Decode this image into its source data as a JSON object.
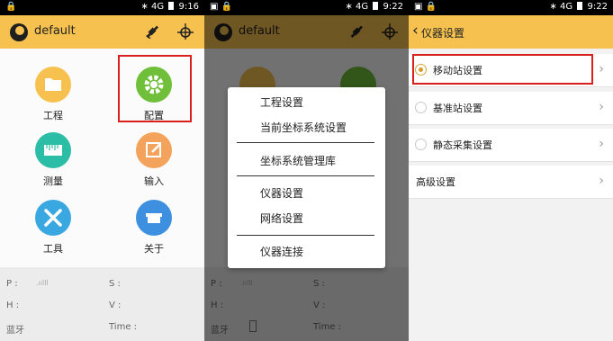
{
  "status_left_1": "🔒",
  "status_p1": {
    "bt": "∗",
    "net": "4G",
    "time": "9:16"
  },
  "status_p2": {
    "bt": "∗",
    "net": "4G",
    "time": "9:22"
  },
  "status_p3": {
    "bt": "∗",
    "net": "4G",
    "time": "9:22"
  },
  "app_title": "default",
  "tiles": [
    {
      "label": "工程",
      "color": "#f6c14e"
    },
    {
      "label": "配置",
      "color": "#6fbf3a"
    },
    {
      "label": "测量",
      "color": "#2cbda6"
    },
    {
      "label": "输入",
      "color": "#f3a35b"
    },
    {
      "label": "工具",
      "color": "#3aa8e0"
    },
    {
      "label": "关于",
      "color": "#3d8fe0"
    }
  ],
  "info": {
    "p": "P :",
    "s": "S :",
    "h": "H :",
    "v": "V :",
    "bt": "蓝牙",
    "time": "Time :"
  },
  "menu": [
    "工程设置",
    "当前坐标系统设置",
    "坐标系统管理库",
    "仪器设置",
    "网络设置",
    "仪器连接"
  ],
  "settings": {
    "back": "‹",
    "title": "仪器设置",
    "rows": [
      "移动站设置",
      "基准站设置",
      "静态采集设置",
      "高级设置"
    ],
    "chevron": "›"
  },
  "colors": {
    "accent": "#f6c14e",
    "highlight": "#d9201f"
  }
}
